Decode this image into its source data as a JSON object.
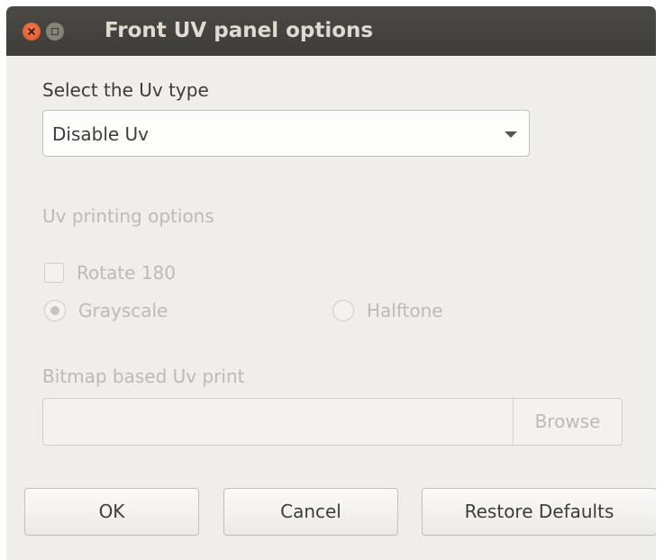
{
  "window": {
    "title": "Front UV panel options"
  },
  "uv_type": {
    "label": "Select the Uv type",
    "selected": "Disable Uv"
  },
  "printing_options": {
    "label": "Uv printing options",
    "rotate_label": "Rotate 180",
    "rotate_checked": false,
    "mode_options": [
      "Grayscale",
      "Halftone"
    ],
    "mode_selected": "Grayscale"
  },
  "bitmap": {
    "label": "Bitmap based Uv print",
    "path": "",
    "browse_label": "Browse"
  },
  "buttons": {
    "ok": "OK",
    "cancel": "Cancel",
    "restore": "Restore Defaults"
  },
  "colors": {
    "titlebar": "#3e3d39",
    "window_bg": "#f0eeeb",
    "close_button": "#e0551f",
    "disabled_text": "#bdbab4",
    "text": "#3c3c3c"
  }
}
